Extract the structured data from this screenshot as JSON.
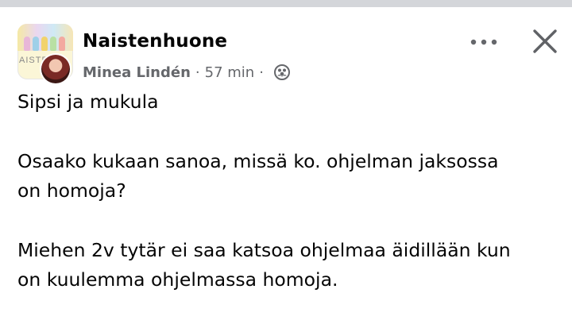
{
  "post": {
    "group_name": "Naistenhuone",
    "group_logo_text": "AISTE",
    "author": "Minea Lindén",
    "separator": "·",
    "time": "57 min",
    "audience_icon": "group-members-icon",
    "paragraphs": [
      "Sipsi ja mukula",
      "Osaako kukaan sanoa, missä ko. ohjelman jaksossa\non homoja?",
      "Miehen 2v tytär ei saa katsoa ohjelmaa äidillään kun\non kuulemma ohjelmassa homoja."
    ]
  },
  "toolbar": {
    "more_icon": "more-options-icon",
    "close_icon": "close-icon"
  },
  "colors": {
    "text_primary": "#050505",
    "text_secondary": "#65676b",
    "top_strip": "#d4d6da"
  }
}
